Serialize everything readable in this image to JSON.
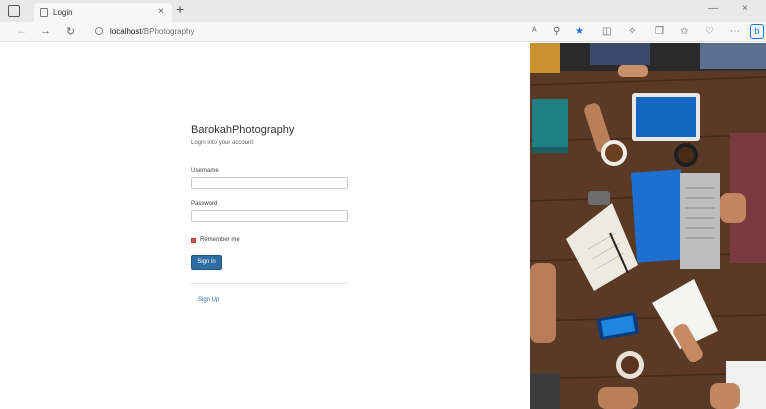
{
  "browser": {
    "tab_title": "Login",
    "tab_close": "×",
    "new_tab": "+",
    "url_host": "localhost",
    "url_path": "/BPhotography",
    "window_minimize": "—",
    "window_close": "×"
  },
  "login": {
    "brand": "BarokahPhotography",
    "subtitle": "Login into your account",
    "username_label": "Username",
    "username_value": "",
    "password_label": "Password",
    "password_value": "",
    "remember_label": "Remember me",
    "remember_checked": true,
    "signin_label": "Sign in",
    "signup_label": "Sign Up"
  },
  "colors": {
    "primary_button": "#2e6da4",
    "checkbox": "#d9534f",
    "link": "#2e6da4",
    "browser_accent": "#1a73e8"
  }
}
